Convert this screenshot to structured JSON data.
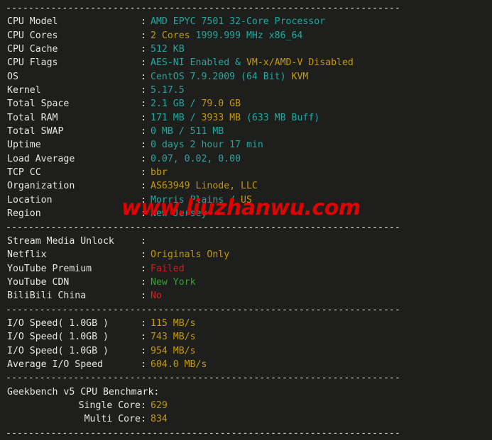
{
  "terminal": {
    "separator": "----------------------------------------------------------------------",
    "colon": ":",
    "watermark": "www.liuzhanwu.com",
    "system_section": [
      {
        "label": "CPU Model",
        "parts": [
          {
            "text": "AMD EPYC 7501 32-Core Processor",
            "color": "cyan"
          }
        ]
      },
      {
        "label": "CPU Cores",
        "parts": [
          {
            "text": "2 Cores",
            "color": "yellow"
          },
          {
            "text": " 1999.999 MHz x86_64",
            "color": "cyan"
          }
        ]
      },
      {
        "label": "CPU Cache",
        "parts": [
          {
            "text": "512 KB",
            "color": "cyan"
          }
        ]
      },
      {
        "label": "CPU Flags",
        "parts": [
          {
            "text": "AES-NI Enabled & ",
            "color": "cyan"
          },
          {
            "text": "VM-x/AMD-V Disabled",
            "color": "yellow"
          }
        ]
      },
      {
        "label": "OS",
        "parts": [
          {
            "text": "CentOS 7.9.2009 (64 Bit) ",
            "color": "cyan"
          },
          {
            "text": "KVM",
            "color": "yellow"
          }
        ]
      },
      {
        "label": "Kernel",
        "parts": [
          {
            "text": "5.17.5",
            "color": "cyan"
          }
        ]
      },
      {
        "label": "Total Space",
        "parts": [
          {
            "text": "2.1 GB",
            "color": "cyan"
          },
          {
            "text": " / ",
            "color": "cyan"
          },
          {
            "text": "79.0 GB",
            "color": "yellow"
          }
        ]
      },
      {
        "label": "Total RAM",
        "parts": [
          {
            "text": "171 MB",
            "color": "cyan"
          },
          {
            "text": " / ",
            "color": "cyan"
          },
          {
            "text": "3933 MB",
            "color": "yellow"
          },
          {
            "text": " (633 MB Buff)",
            "color": "cyan"
          }
        ]
      },
      {
        "label": "Total SWAP",
        "parts": [
          {
            "text": "0 MB / 511 MB",
            "color": "cyan"
          }
        ]
      },
      {
        "label": "Uptime",
        "parts": [
          {
            "text": "0 days 2 hour 17 min",
            "color": "cyan"
          }
        ]
      },
      {
        "label": "Load Average",
        "parts": [
          {
            "text": "0.07, 0.02, 0.00",
            "color": "cyan"
          }
        ]
      },
      {
        "label": "TCP CC",
        "parts": [
          {
            "text": "bbr",
            "color": "yellow"
          }
        ]
      },
      {
        "label": "Organization",
        "parts": [
          {
            "text": "AS63949 Linode, LLC",
            "color": "yellow"
          }
        ]
      },
      {
        "label": "Location",
        "parts": [
          {
            "text": "Morris Plains",
            "color": "cyan"
          },
          {
            "text": " / ",
            "color": "cyan"
          },
          {
            "text": "US",
            "color": "yellow"
          }
        ]
      },
      {
        "label": "Region",
        "parts": [
          {
            "text": "New Jersey",
            "color": "cyan"
          }
        ]
      }
    ],
    "stream_section": [
      {
        "label": "Stream Media Unlock",
        "parts": []
      },
      {
        "label": "Netflix",
        "parts": [
          {
            "text": "Originals Only",
            "color": "yellow"
          }
        ]
      },
      {
        "label": "YouTube Premium",
        "parts": [
          {
            "text": "Failed",
            "color": "red"
          }
        ]
      },
      {
        "label": "YouTube CDN",
        "parts": [
          {
            "text": "New York",
            "color": "green"
          }
        ]
      },
      {
        "label": "BiliBili China",
        "parts": [
          {
            "text": "No",
            "color": "red"
          }
        ]
      }
    ],
    "io_section": [
      {
        "label": "I/O Speed( 1.0GB )",
        "parts": [
          {
            "text": "115 MB/s",
            "color": "yellow"
          }
        ]
      },
      {
        "label": "I/O Speed( 1.0GB )",
        "parts": [
          {
            "text": "743 MB/s",
            "color": "yellow"
          }
        ]
      },
      {
        "label": "I/O Speed( 1.0GB )",
        "parts": [
          {
            "text": "954 MB/s",
            "color": "yellow"
          }
        ]
      },
      {
        "label": "Average I/O Speed",
        "parts": [
          {
            "text": "604.0 MB/s",
            "color": "yellow"
          }
        ]
      }
    ],
    "geekbench": {
      "title": "Geekbench v5 CPU Benchmark:",
      "rows": [
        {
          "label": "Single Core",
          "parts": [
            {
              "text": "629",
              "color": "yellow"
            }
          ]
        },
        {
          "label": "Multi Core",
          "parts": [
            {
              "text": "834",
              "color": "yellow"
            }
          ]
        }
      ]
    }
  },
  "colors": {
    "background": "#1e1f1c",
    "foreground": "#e6e6e1",
    "cyan": "#1fa8a0",
    "yellow": "#c49a00",
    "red": "#cc2222",
    "green": "#35a035",
    "watermark": "#e20000"
  }
}
